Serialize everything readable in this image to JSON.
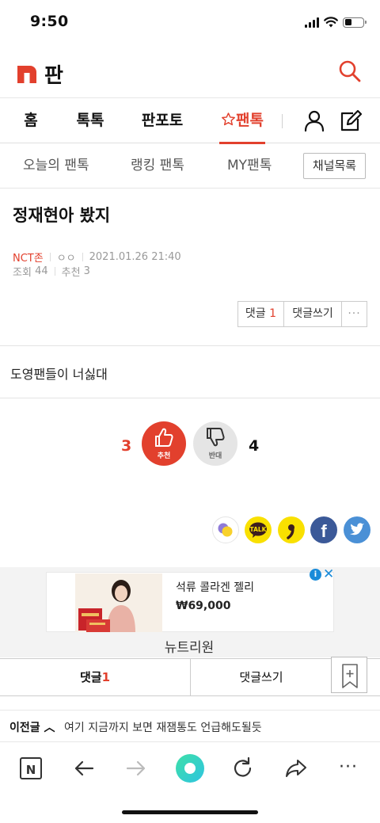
{
  "status_bar": {
    "time": "9:50"
  },
  "header": {
    "title": "판"
  },
  "main_nav": {
    "items": [
      {
        "label": "홈"
      },
      {
        "label": "톡톡"
      },
      {
        "label": "판포토"
      },
      {
        "label": "팬톡"
      }
    ]
  },
  "sub_nav": {
    "items": [
      {
        "label": "오늘의 팬톡"
      },
      {
        "label": "랭킹 팬톡"
      },
      {
        "label": "MY팬톡"
      }
    ],
    "channel_button": "채널목록"
  },
  "post": {
    "title": "정재현아 봤지",
    "category": "NCT존",
    "author": "ㅇㅇ",
    "date": "2021.01.26 21:40",
    "views_label": "조회",
    "views": "44",
    "recommend_label": "추천",
    "recommend": "3",
    "body": "도영팬들이 너싫대"
  },
  "actions": {
    "comments_label": "댓글",
    "comments_count": "1",
    "write_label": "댓글쓰기",
    "more": "···"
  },
  "votes": {
    "up_count": "3",
    "up_label": "추천",
    "down_label": "반대",
    "down_count": "4"
  },
  "share": [
    "kakaostory-icon",
    "kakaotalk-icon",
    "kakao-channel-icon",
    "facebook-icon",
    "twitter-icon"
  ],
  "share_labels": {
    "kakaotalk": "TALK",
    "facebook": "f"
  },
  "ad": {
    "product": "석류 콜라겐 젤리",
    "price": "₩69,000",
    "brand": "뉴트리원",
    "info": "i",
    "close": "✕"
  },
  "comment_bar": {
    "comments_label": "댓글",
    "comments_count": "1",
    "write_label": "댓글쓰기"
  },
  "prev_post": {
    "label": "이전글",
    "arrow": "︿",
    "title": "여기 지금까지 보면 재잼통도 언급해도될듯"
  },
  "browser": {
    "home_label": "N",
    "more": "···"
  },
  "colors": {
    "accent": "#e2402d",
    "ad_blue": "#1a8bd9"
  }
}
